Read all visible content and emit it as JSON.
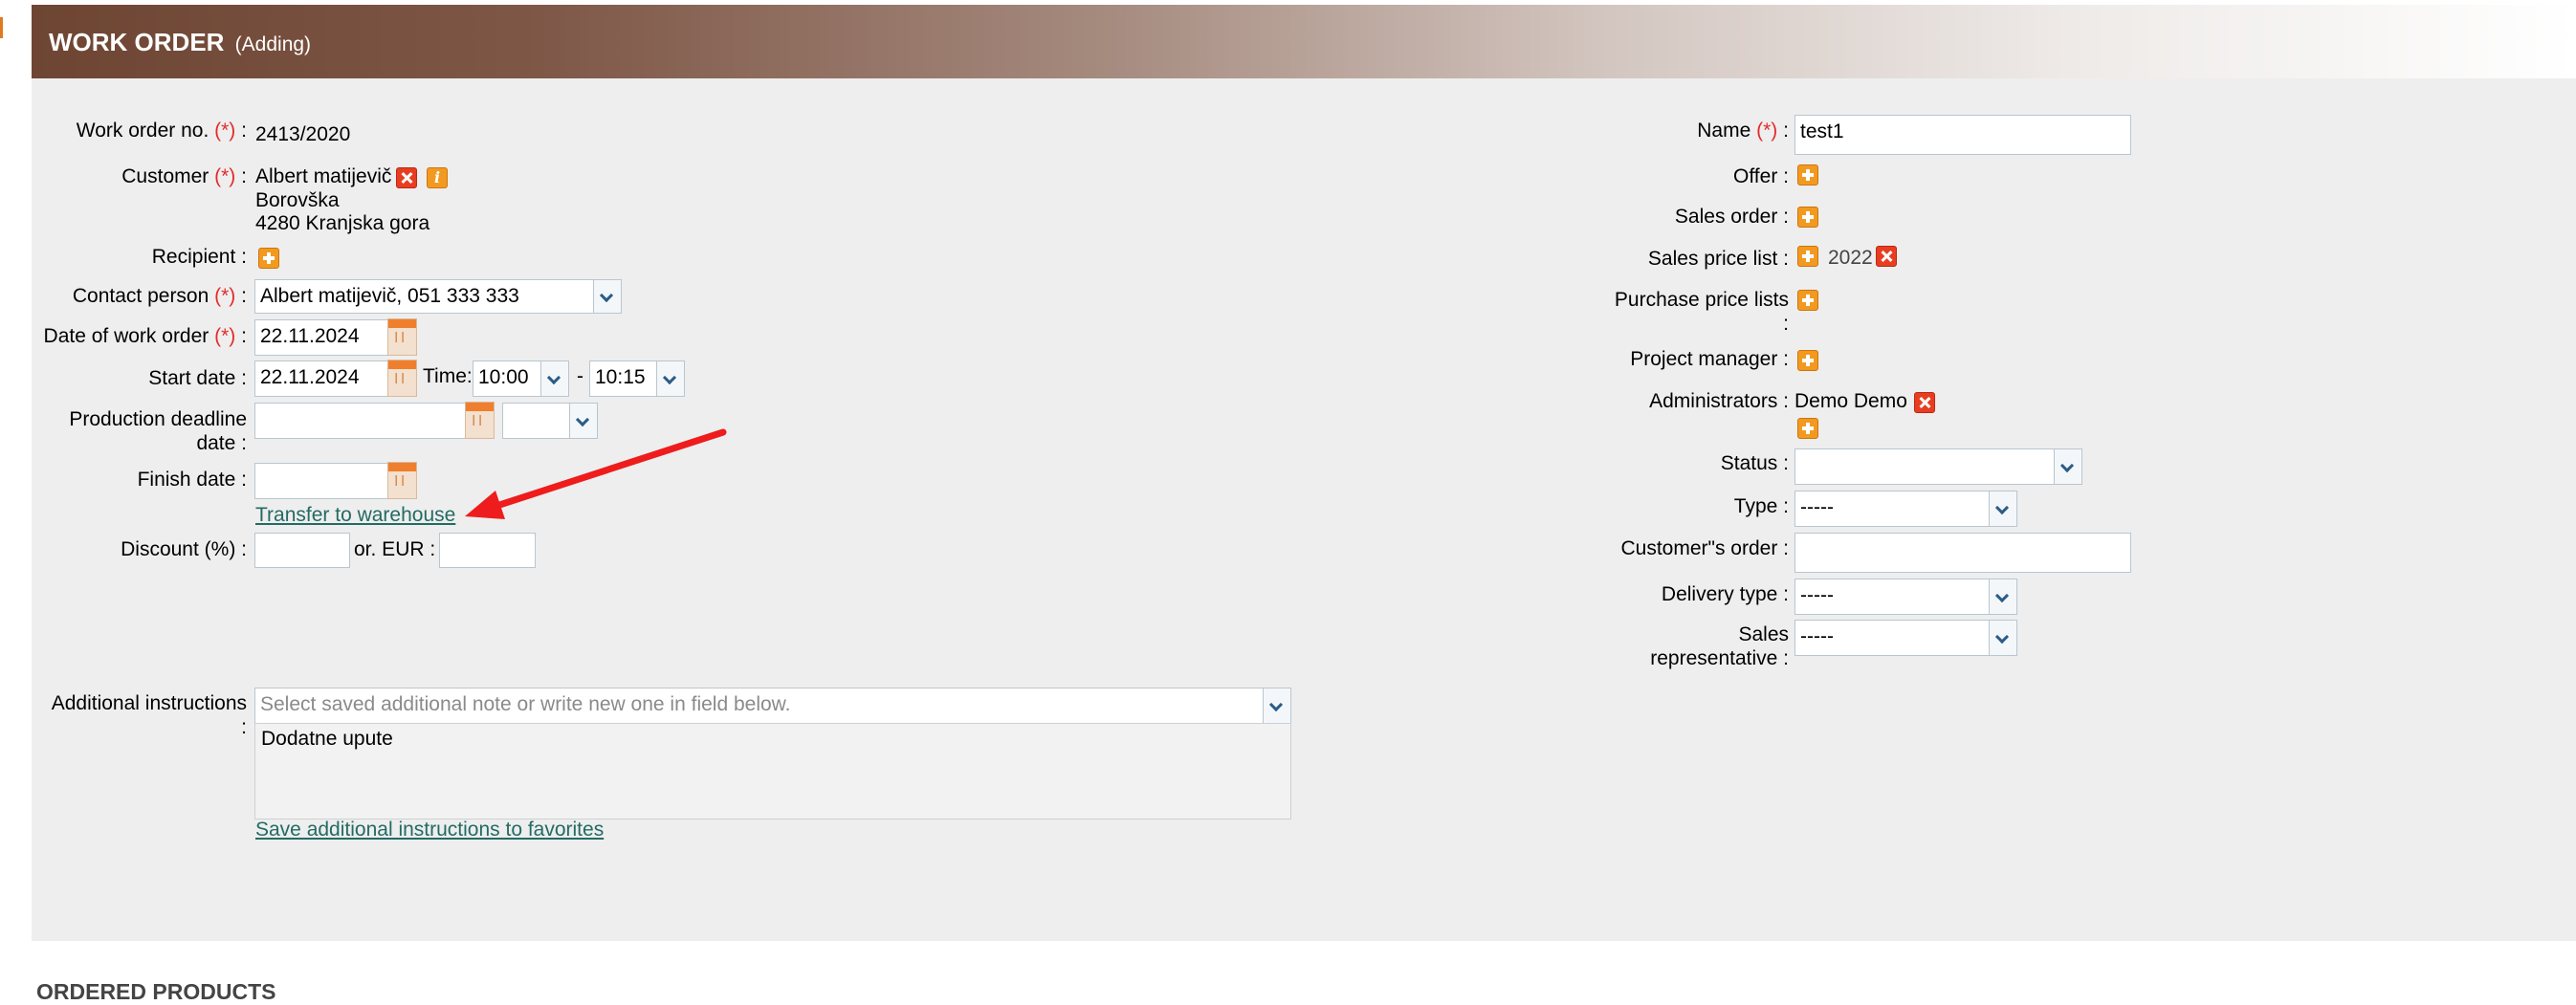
{
  "header": {
    "title": "WORK ORDER",
    "subtitle": "(Adding)"
  },
  "req_marker": "(*)",
  "colon": ":",
  "left": {
    "work_order_no": {
      "label": "Work order no.",
      "value": "2413/2020"
    },
    "customer": {
      "label": "Customer",
      "name": "Albert matijevič",
      "street": "Borovška",
      "city": "4280 Kranjska gora"
    },
    "recipient": {
      "label": "Recipient"
    },
    "contact_person": {
      "label": "Contact person",
      "value": "Albert matijevič, 051 333 333"
    },
    "date_of_work_order": {
      "label": "Date of work order",
      "value": "22.11.2024"
    },
    "start_date": {
      "label": "Start date",
      "value": "22.11.2024",
      "time_label": "Time:",
      "time_from": "10:00",
      "dash": "-",
      "time_to": "10:15"
    },
    "production_deadline": {
      "label_line1": "Production deadline",
      "label_line2": "date",
      "value": "",
      "time": ""
    },
    "finish_date": {
      "label": "Finish date",
      "value": ""
    },
    "transfer_link": "Transfer to warehouse",
    "discount": {
      "label": "Discount (%)",
      "value": "",
      "or_label": "or. EUR",
      "eur_value": ""
    },
    "additional_instructions": {
      "label": "Additional instructions",
      "placeholder": "Select saved additional note or write new one in field below.",
      "text": "Dodatne upute",
      "save_link": "Save additional instructions to favorites"
    }
  },
  "right": {
    "name": {
      "label": "Name",
      "value": "test1"
    },
    "offer": {
      "label": "Offer"
    },
    "sales_order": {
      "label": "Sales order"
    },
    "sales_price_list": {
      "label": "Sales price list",
      "value": "2022"
    },
    "purchase_price_lists": {
      "label": "Purchase price lists"
    },
    "project_manager": {
      "label": "Project manager"
    },
    "administrators": {
      "label": "Administrators",
      "value": "Demo Demo"
    },
    "status": {
      "label": "Status",
      "value": ""
    },
    "type": {
      "label": "Type",
      "value": "-----"
    },
    "customers_order": {
      "label": "Customer\"s order",
      "value": ""
    },
    "delivery_type": {
      "label": "Delivery type",
      "value": "-----"
    },
    "sales_representative": {
      "label_line1": "Sales",
      "label_line2": "representative",
      "value": "-----"
    }
  },
  "next_section": "ORDERED PRODUCTS",
  "icons": [
    "remove-icon",
    "info-icon",
    "add-icon",
    "calendar-icon",
    "chevron-down-icon"
  ],
  "colors": {
    "header": "#6e4533",
    "panel": "#eeeeee",
    "required": "#e32b2b",
    "link": "#236b64",
    "add_icon": "#f29a1f",
    "remove_icon": "#e83d21"
  }
}
